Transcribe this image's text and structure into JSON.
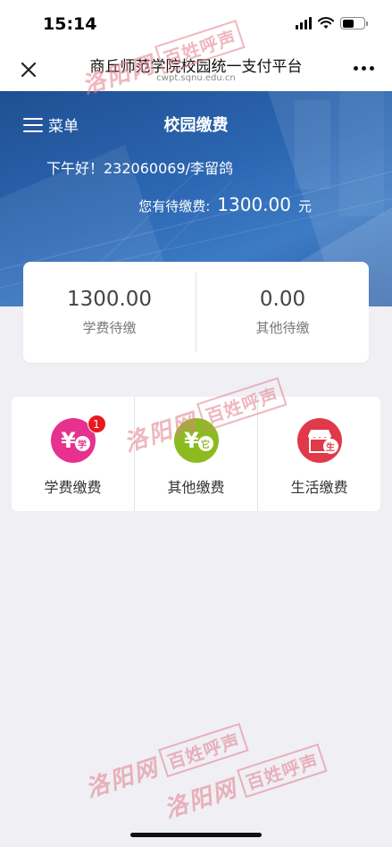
{
  "status": {
    "time": "15:14"
  },
  "nav": {
    "title": "商丘师范学院校园统一支付平台",
    "url": "cwpt.sqnu.edu.cn"
  },
  "banner": {
    "menu_label": "菜单",
    "title": "校园缴费",
    "greeting": "下午好！232060069/李留鸽",
    "pending_label": "您有待缴费:",
    "pending_amount": "1300.00",
    "pending_unit": "元"
  },
  "summary": [
    {
      "value": "1300.00",
      "label": "学费待缴"
    },
    {
      "value": "0.00",
      "label": "其他待缴"
    }
  ],
  "pay_items": [
    {
      "label": "学费缴费",
      "icon": "tuition-yen-icon",
      "color": "#e6318f",
      "tag": "学",
      "badge": "1"
    },
    {
      "label": "其他缴费",
      "icon": "other-yen-icon",
      "color": "#8cbb1f",
      "tag": "它"
    },
    {
      "label": "生活缴费",
      "icon": "life-shop-icon",
      "color": "#e0394a",
      "tag": "生"
    }
  ],
  "watermark": {
    "script": "洛阳网",
    "box": "百姓呼声"
  },
  "colors": {
    "banner": "#2c67b3",
    "background": "#efeff4",
    "badge": "#e8191f"
  }
}
